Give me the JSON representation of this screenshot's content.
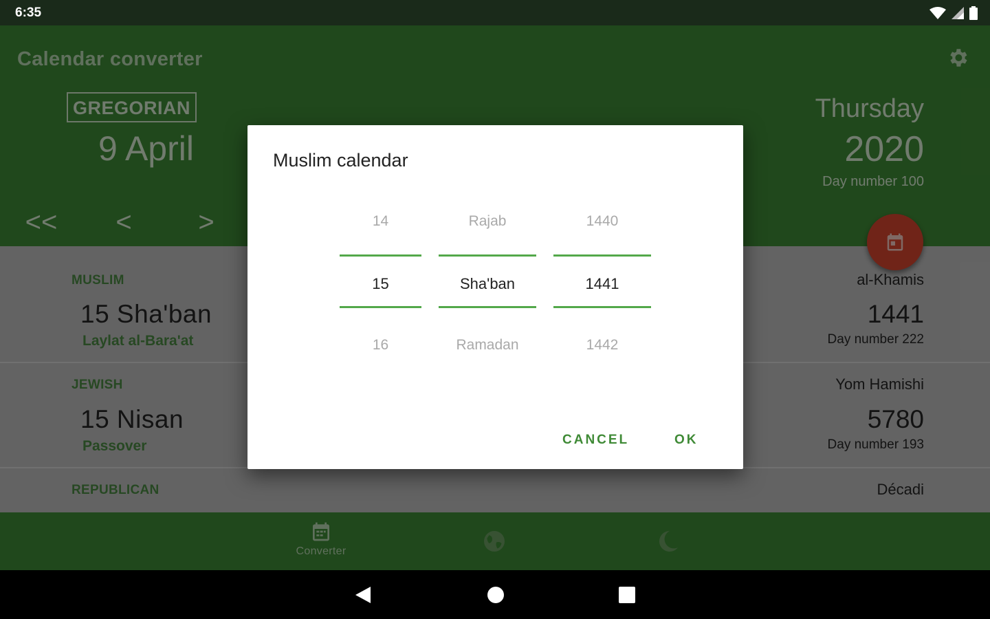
{
  "status_bar": {
    "time": "6:35",
    "icons": [
      "wifi-icon",
      "signal-icon",
      "battery-icon"
    ]
  },
  "header": {
    "app_title": "Calendar converter",
    "calendar_label": "GREGORIAN",
    "date": "9 April",
    "weekday": "Thursday",
    "year": "2020",
    "day_number": "Day number 100",
    "nav": {
      "first": "<<",
      "prev": "<",
      "next": ">"
    }
  },
  "rows": [
    {
      "label": "MUSLIM",
      "date": "15 Sha'ban",
      "event": "Laylat al-Bara'at",
      "right_top": "al-Khamis",
      "right_year": "1441",
      "right_day": "Day number 222"
    },
    {
      "label": "JEWISH",
      "date": "15 Nisan",
      "event": "Passover",
      "right_top": "Yom Hamishi",
      "right_year": "5780",
      "right_day": "Day number 193"
    },
    {
      "label": "REPUBLICAN",
      "right_top": "Décadi"
    }
  ],
  "bottom_nav": {
    "converter_label": "Converter"
  },
  "dialog": {
    "title": "Muslim calendar",
    "day": {
      "prev": "14",
      "selected": "15",
      "next": "16"
    },
    "month": {
      "prev": "Rajab",
      "selected": "Sha'ban",
      "next": "Ramadan"
    },
    "year": {
      "prev": "1440",
      "selected": "1441",
      "next": "1442"
    },
    "cancel": "CANCEL",
    "ok": "OK"
  },
  "colors": {
    "primary": "#3f8a36",
    "accent": "#d6452e",
    "divider": "#53a84a"
  }
}
